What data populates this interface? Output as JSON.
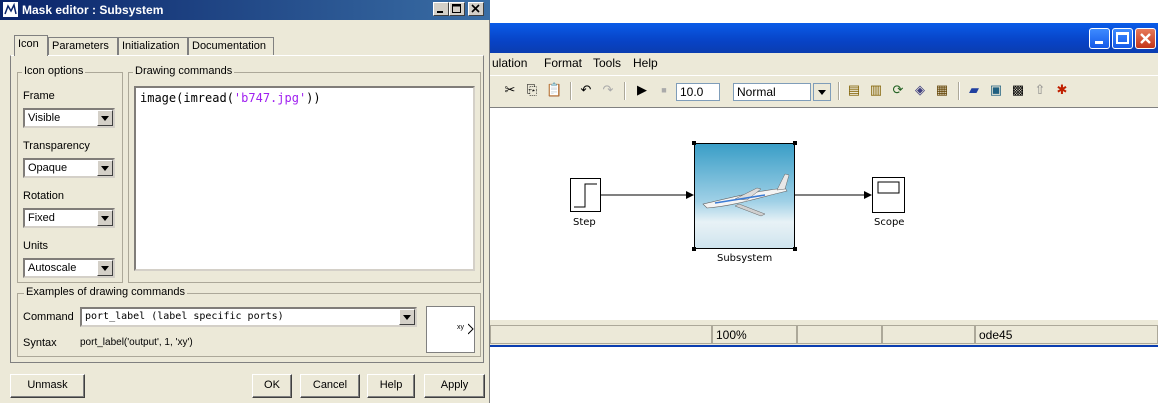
{
  "mask_editor": {
    "title": "Mask editor : Subsystem",
    "tabs": [
      {
        "label": "Icon",
        "active": true
      },
      {
        "label": "Parameters",
        "active": false
      },
      {
        "label": "Initialization",
        "active": false
      },
      {
        "label": "Documentation",
        "active": false
      }
    ],
    "icon_options": {
      "title": "Icon options",
      "frame_label": "Frame",
      "frame_value": "Visible",
      "transparency_label": "Transparency",
      "transparency_value": "Opaque",
      "rotation_label": "Rotation",
      "rotation_value": "Fixed",
      "units_label": "Units",
      "units_value": "Autoscale"
    },
    "drawing_commands": {
      "title": "Drawing commands",
      "code_prefix": "image(imread(",
      "code_string": "'b747.jpg'",
      "code_suffix": "))"
    },
    "examples": {
      "title": "Examples of drawing commands",
      "command_label": "Command",
      "command_value": "port_label (label specific ports)",
      "syntax_label": "Syntax",
      "syntax_value": "port_label('output', 1, 'xy')",
      "preview_text": "xy"
    },
    "buttons": {
      "unmask": "Unmask",
      "ok": "OK",
      "cancel": "Cancel",
      "help": "Help",
      "apply": "Apply"
    }
  },
  "simulink": {
    "menu": {
      "simulation_partial": "ulation",
      "format": "Format",
      "tools": "Tools",
      "help": "Help"
    },
    "toolbar": {
      "stop_time": "10.0",
      "sim_mode": "Normal"
    },
    "blocks": {
      "step": "Step",
      "subsystem": "Subsystem",
      "scope": "Scope"
    },
    "status": {
      "zoom": "100%",
      "solver": "ode45"
    },
    "colors": {
      "titlebar": "#0a5ce8",
      "close": "#c4351a",
      "string": "#a020f0"
    }
  }
}
